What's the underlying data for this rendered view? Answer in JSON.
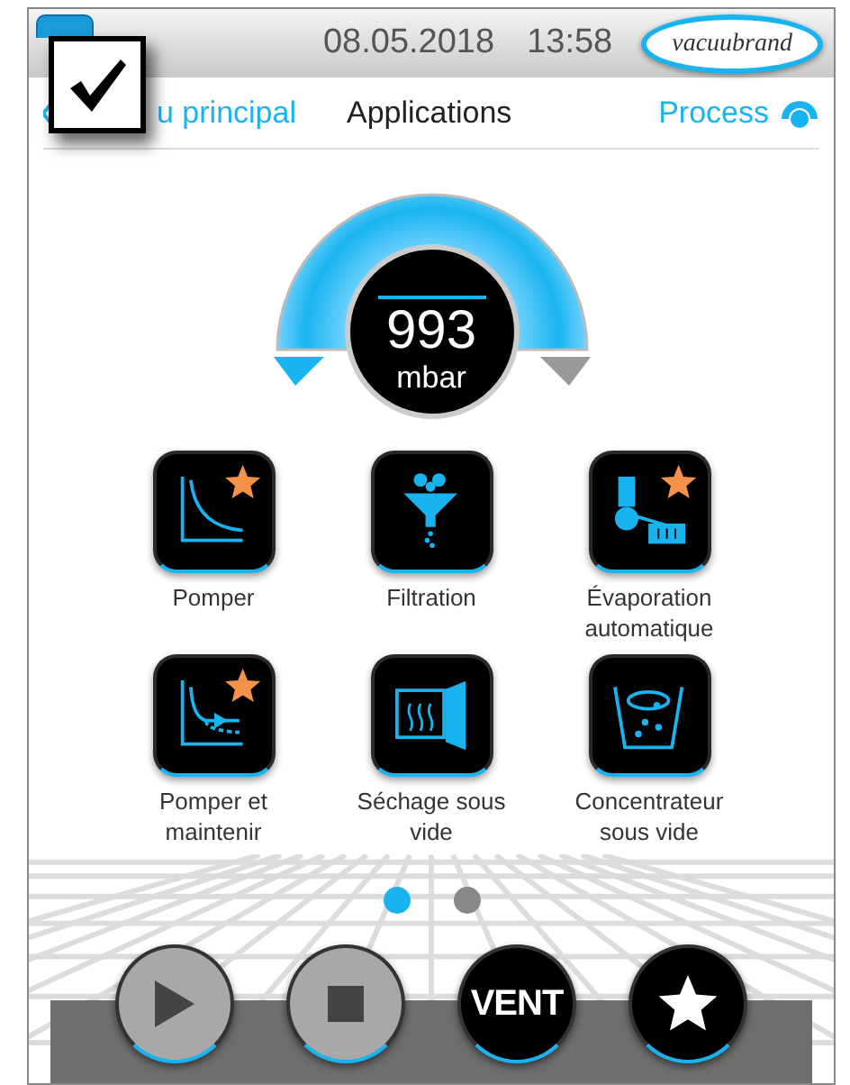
{
  "status_bar": {
    "date": "08.05.2018",
    "time": "13:58",
    "brand": "vacuubrand"
  },
  "overlay": {
    "checked": true
  },
  "nav": {
    "back": "u principal",
    "title": "Applications",
    "process": "Process"
  },
  "gauge": {
    "value": "993",
    "unit": "mbar"
  },
  "applications": [
    {
      "label": "Pomper",
      "kind": "pump",
      "starred": true
    },
    {
      "label": "Filtration",
      "kind": "filtration",
      "starred": false
    },
    {
      "label": "Évaporation automatique",
      "kind": "evaporation",
      "starred": true
    },
    {
      "label": "Pomper et maintenir",
      "kind": "pump_hold",
      "starred": true
    },
    {
      "label": "Séchage sous vide",
      "kind": "drying",
      "starred": false
    },
    {
      "label": "Concentrateur sous vide",
      "kind": "concentrator",
      "starred": false
    }
  ],
  "pages": [
    {
      "selected": true
    },
    {
      "selected": false
    }
  ],
  "controls": [
    {
      "kind": "play",
      "disabled": true
    },
    {
      "kind": "stop",
      "disabled": true
    },
    {
      "kind": "vent",
      "label": "VENT",
      "disabled": false
    },
    {
      "kind": "favorite",
      "disabled": false
    }
  ]
}
